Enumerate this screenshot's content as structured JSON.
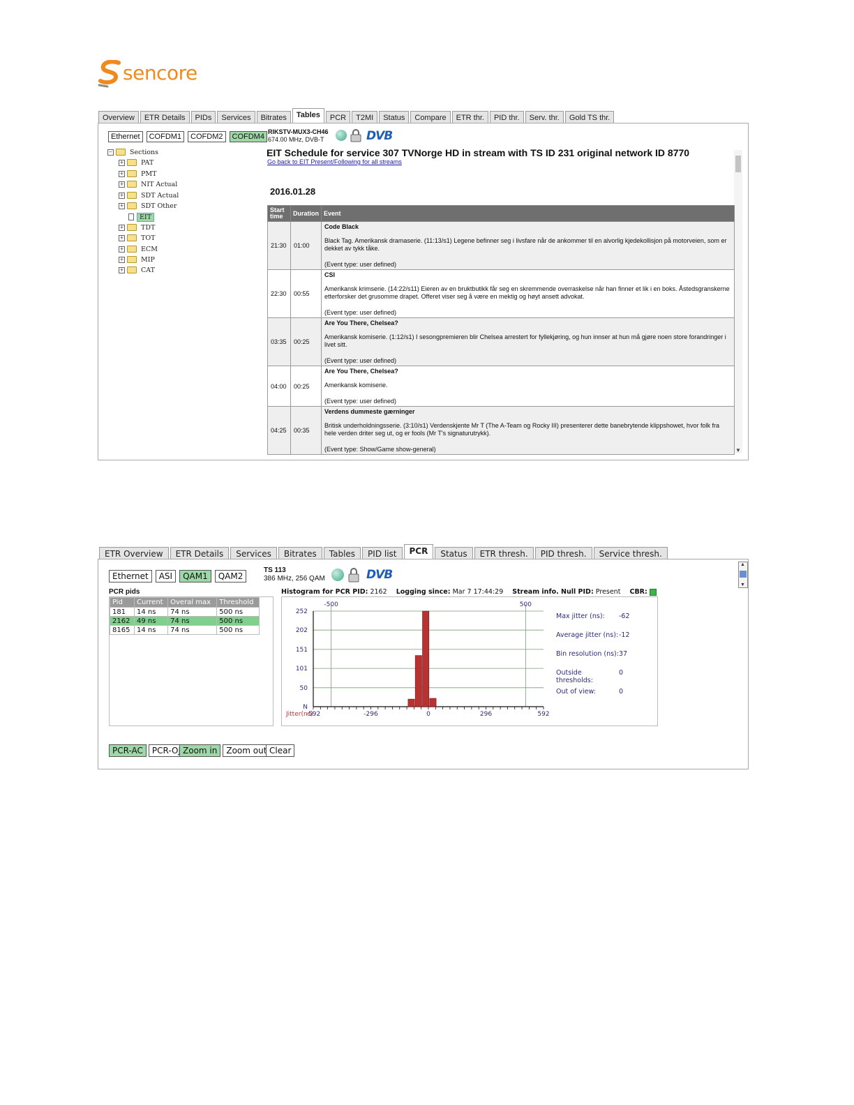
{
  "logo": {
    "text": "sencore",
    "brand_color": "#f08a1c"
  },
  "screen1": {
    "tabs": [
      "Overview",
      "ETR Details",
      "PIDs",
      "Services",
      "Bitrates",
      "Tables",
      "PCR",
      "T2MI",
      "Status",
      "Compare",
      "ETR thr.",
      "PID thr.",
      "Serv. thr.",
      "Gold TS thr."
    ],
    "active_tab": "Tables",
    "inputs": [
      "Ethernet",
      "COFDM1",
      "COFDM2",
      "COFDM4"
    ],
    "active_input": "COFDM4",
    "stream_name": "RIKSTV-MUX3-CH46",
    "stream_freq": "674.00 MHz, DVB-T",
    "dvb_logo": "DVB",
    "tree": {
      "root": "Sections",
      "items": [
        "PAT",
        "PMT",
        "NIT Actual",
        "SDT Actual",
        "SDT Other",
        "EIT",
        "TDT",
        "TOT",
        "ECM",
        "MIP",
        "CAT"
      ],
      "selected": "EIT"
    },
    "title": "EIT Schedule for service 307 TVNorge HD in stream with TS ID 231 original network ID 8770",
    "back_link": "Go back to EIT Present/Following for all streams",
    "date": "2016.01.28",
    "columns": [
      "Start time",
      "Duration",
      "Event"
    ],
    "events": [
      {
        "start": "21:30",
        "duration": "01:00",
        "title": "Code Black",
        "desc": "Black Tag. Amerikansk dramaserie. (11:13/s1) Legene befinner seg i livsfare når de ankommer til en alvorlig kjedekollisjon på motorveien, som er dekket av tykk tåke.",
        "type": "(Event type: user defined)"
      },
      {
        "start": "22:30",
        "duration": "00:55",
        "title": "CSI",
        "desc": "Amerikansk krimserie. (14:22/s11) Eieren av en bruktbutikk får seg en skremmende overraskelse når han finner et lik i en boks. Åstedsgranskerne etterforsker det grusomme drapet. Offeret viser seg å være en mektig og høyt ansett advokat.",
        "type": "(Event type: user defined)"
      },
      {
        "start": "03:35",
        "duration": "00:25",
        "title": "Are You There, Chelsea?",
        "desc": "Amerikansk komiserie. (1:12/s1) I sesongpremieren blir Chelsea arrestert for fyllekjøring, og hun innser at hun må gjøre noen store forandringer i livet sitt.",
        "type": "(Event type: user defined)"
      },
      {
        "start": "04:00",
        "duration": "00:25",
        "title": "Are You There, Chelsea?",
        "desc": "Amerikansk komiserie.",
        "type": "(Event type: user defined)"
      },
      {
        "start": "04:25",
        "duration": "00:35",
        "title": "Verdens dummeste gærninger",
        "desc": "Britisk underholdningsserie. (3:10/s1) Verdenskjente Mr T (The A-Team og Rocky III) presenterer dette banebrytende klippshowet, hvor folk fra hele verden driter seg ut, og er fools (Mr T's signaturutrykk).",
        "type": "(Event type: Show/Game show-general)"
      }
    ]
  },
  "screen2": {
    "tabs": [
      "ETR Overview",
      "ETR Details",
      "Services",
      "Bitrates",
      "Tables",
      "PID list",
      "PCR",
      "Status",
      "ETR thresh.",
      "PID thresh.",
      "Service thresh."
    ],
    "active_tab": "PCR",
    "inputs": [
      "Ethernet",
      "ASI",
      "QAM1",
      "QAM2"
    ],
    "active_input": "QAM1",
    "stream_name": "TS 113",
    "stream_freq": "386 MHz, 256 QAM",
    "dvb_logo": "DVB",
    "pcr_pids_title": "PCR pids",
    "pid_columns": [
      "Pid",
      "Current",
      "Overal max",
      "Threshold"
    ],
    "pid_rows": [
      [
        "181",
        "14 ns",
        "74 ns",
        "500 ns"
      ],
      [
        "2162",
        "49 ns",
        "74 ns",
        "500 ns"
      ],
      [
        "8165",
        "14 ns",
        "74 ns",
        "500 ns"
      ]
    ],
    "selected_pid_row": 1,
    "hist_header": {
      "label_pid": "Histogram for PCR PID:",
      "pid": "2162",
      "label_logging": "Logging since:",
      "logging": "Mar 7 17:44:29",
      "label_stream": "Stream info. Null PID:",
      "stream": "Present",
      "label_cbr": "CBR:"
    },
    "stats": [
      {
        "label": "Max jitter (ns):",
        "value": "-62"
      },
      {
        "label": "Average jitter (ns):",
        "value": "-12"
      },
      {
        "label": "Bin resolution (ns):",
        "value": "37"
      },
      {
        "label": "Outside thresholds:",
        "value": "0"
      },
      {
        "label": "Out of view:",
        "value": "0"
      }
    ],
    "buttons": [
      "PCR-AC",
      "PCR-OJ",
      "Zoom in",
      "Zoom out",
      "Clear"
    ],
    "active_buttons": [
      "PCR-AC",
      "Zoom in"
    ]
  },
  "chart_data": {
    "type": "bar",
    "title": "Histogram for PCR PID: 2162",
    "xlabel": "Jitter(ns)",
    "ylabel": "N",
    "x_ticks": [
      "-592",
      "-296",
      "0",
      "296",
      "592"
    ],
    "y_ticks": [
      "N",
      "50",
      "101",
      "151",
      "202",
      "252"
    ],
    "threshold_labels": [
      "-500",
      "500"
    ],
    "thresholds": [
      -500,
      500
    ],
    "xlim": [
      -592,
      592
    ],
    "ylim": [
      0,
      252
    ],
    "bins": [
      {
        "x": -86,
        "count": 20
      },
      {
        "x": -49,
        "count": 135
      },
      {
        "x": -12,
        "count": 252
      },
      {
        "x": 25,
        "count": 22
      }
    ],
    "bin_width": 37,
    "bar_color": "#b83232",
    "grid": true
  }
}
